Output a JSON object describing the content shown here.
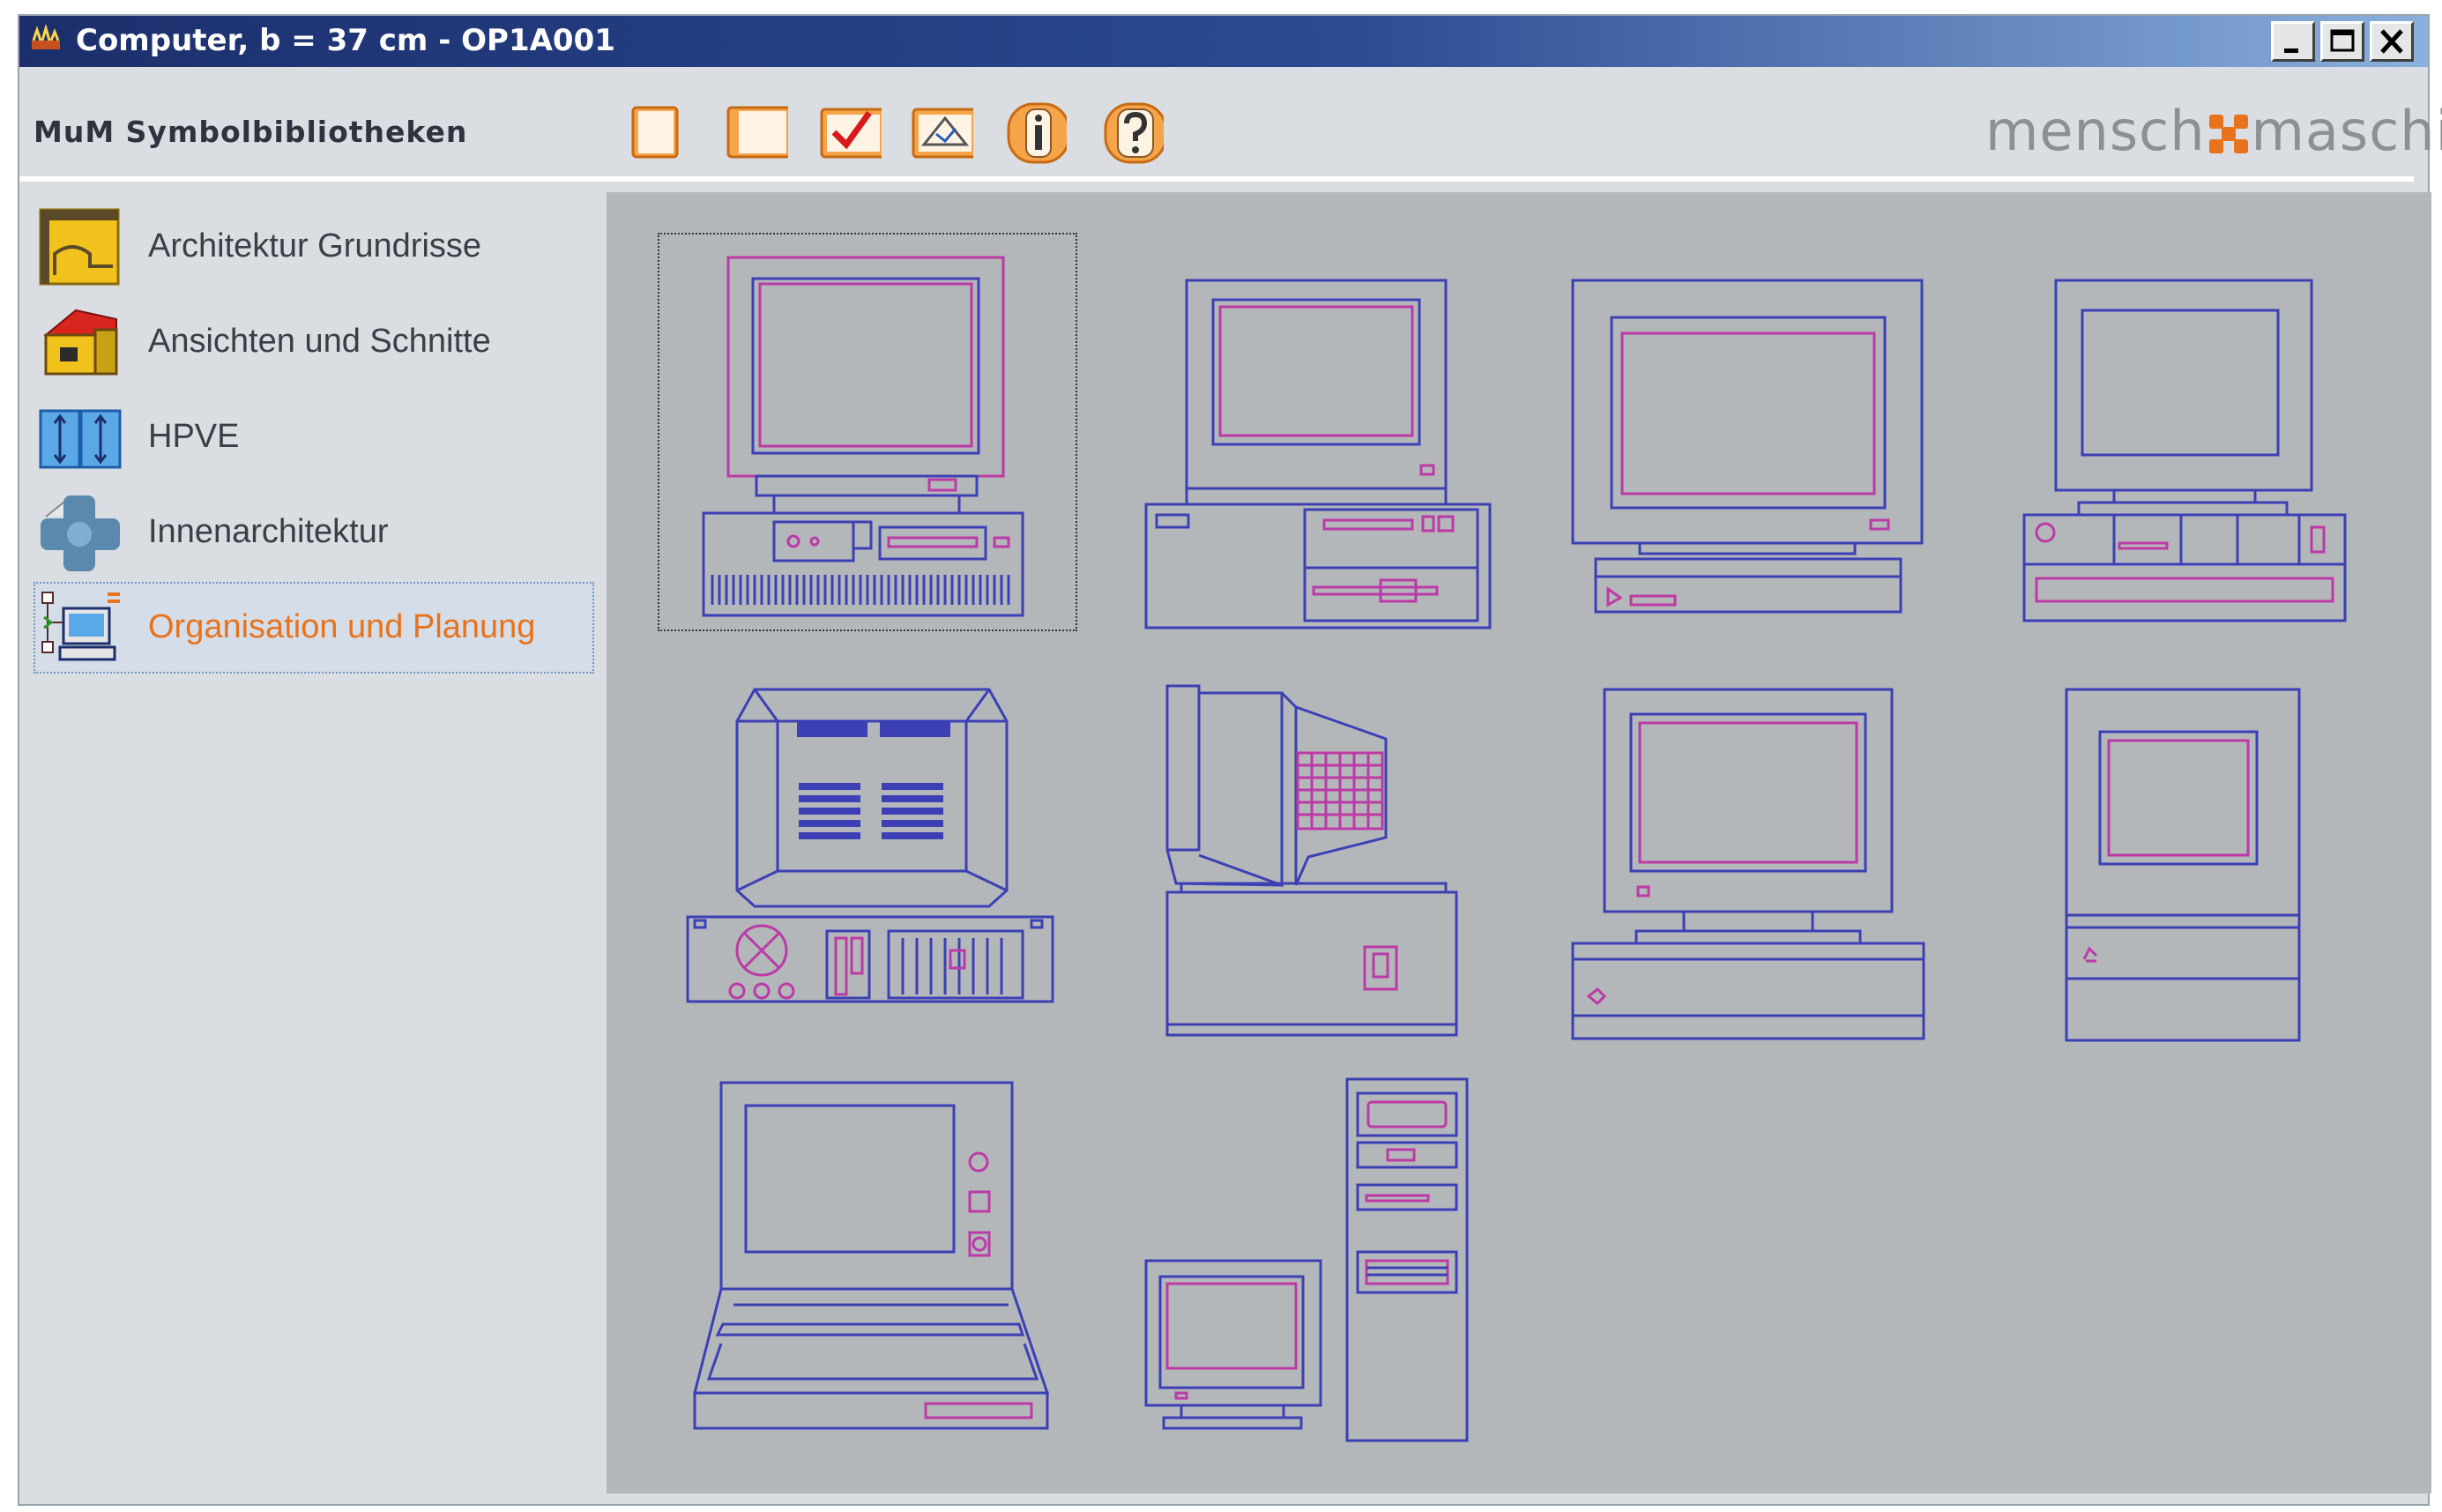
{
  "window": {
    "title": "Computer, b = 37 cm - OP1A001",
    "controls": [
      "minimize",
      "maximize",
      "close"
    ]
  },
  "header": {
    "library_label": "MuM Symbolbibliotheken",
    "brand_left": "mensch",
    "brand_right": "maschine",
    "toolbar": [
      {
        "icon": "new-page-icon"
      },
      {
        "icon": "open-page-icon"
      },
      {
        "icon": "checkmark-icon"
      },
      {
        "icon": "insert-symbol-icon"
      },
      {
        "icon": "info-icon"
      },
      {
        "icon": "help-icon"
      }
    ]
  },
  "sidebar": {
    "items": [
      {
        "label": "Architektur Grundrisse",
        "icon": "floor-plan-icon",
        "selected": false
      },
      {
        "label": "Ansichten und Schnitte",
        "icon": "house-icon",
        "selected": false
      },
      {
        "label": "HPVE",
        "icon": "hpve-icon",
        "selected": false
      },
      {
        "label": "Innenarchitektur",
        "icon": "interior-icon",
        "selected": false
      },
      {
        "label": "Organisation und Planung",
        "icon": "computer-network-icon",
        "selected": true
      }
    ]
  },
  "grid": {
    "selected_index": 0,
    "symbols": [
      "computer-symbol-1",
      "computer-symbol-2",
      "computer-symbol-3",
      "computer-symbol-4",
      "computer-symbol-5",
      "computer-symbol-6",
      "computer-symbol-7",
      "computer-symbol-8",
      "laptop-symbol",
      "tower-computer-symbol"
    ]
  },
  "colors": {
    "accent_selected": "#e8731c",
    "symbol_blue": "#3c40b4",
    "symbol_magenta": "#bb3aa6",
    "titlebar": "#1c2f6c"
  }
}
